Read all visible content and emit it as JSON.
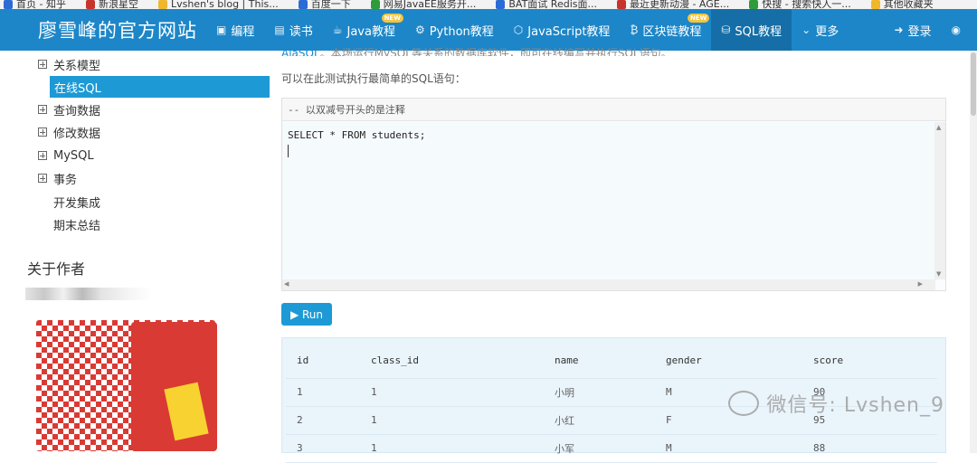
{
  "bookmarks": [
    {
      "label": "首页 - 知乎"
    },
    {
      "label": "新浪星空"
    },
    {
      "label": "Lvshen's blog | This..."
    },
    {
      "label": "百度一下"
    },
    {
      "label": "网易JavaEE服务开..."
    },
    {
      "label": "BAT面试 Redis面..."
    },
    {
      "label": "最近更新动漫 - AGE..."
    },
    {
      "label": "快搜 - 搜索快人一..."
    },
    {
      "label": "其他收藏夹"
    }
  ],
  "nav": {
    "brand": "廖雪峰的官方网站",
    "items": [
      {
        "icon": "▣",
        "label": "编程",
        "new": ""
      },
      {
        "icon": "▤",
        "label": "读书",
        "new": ""
      },
      {
        "icon": "☕",
        "label": "Java教程",
        "new": "NEW"
      },
      {
        "icon": "⚙",
        "label": "Python教程",
        "new": ""
      },
      {
        "icon": "⬡",
        "label": "JavaScript教程",
        "new": ""
      },
      {
        "icon": "₿",
        "label": "区块链教程",
        "new": "NEW"
      },
      {
        "icon": "⛁",
        "label": "SQL教程",
        "new": ""
      },
      {
        "icon": "⌄",
        "label": "更多",
        "new": ""
      }
    ],
    "login": {
      "icon": "➜",
      "label": "登录"
    },
    "globe_icon": "◉"
  },
  "sidebar": {
    "items": [
      {
        "label": "关系模型",
        "expandable": true
      },
      {
        "label": "在线SQL",
        "expandable": false,
        "active": true
      },
      {
        "label": "查询数据",
        "expandable": true
      },
      {
        "label": "修改数据",
        "expandable": true
      },
      {
        "label": "MySQL",
        "expandable": true
      },
      {
        "label": "事务",
        "expandable": true
      },
      {
        "label": "开发集成",
        "expandable": false
      },
      {
        "label": "期末总结",
        "expandable": false
      }
    ],
    "about_title": "关于作者"
  },
  "content": {
    "cut_line_link": "AlaSQL",
    "cut_line_text": "。本场运行MySQL等关系的数据库软件，即可在线编写并执行SQL语句。",
    "intro": "可以在此测试执行最简单的SQL语句：",
    "editor": {
      "comment": "-- 以双减号开头的是注释",
      "code": "SELECT * FROM students;"
    },
    "run_button": "▶ Run",
    "result": {
      "headers": [
        "id",
        "class_id",
        "name",
        "gender",
        "score"
      ],
      "rows": [
        [
          "1",
          "1",
          "小明",
          "M",
          "90"
        ],
        [
          "2",
          "1",
          "小红",
          "F",
          "95"
        ],
        [
          "3",
          "1",
          "小军",
          "M",
          "88"
        ]
      ]
    }
  },
  "watermark": "微信号: Lvshen_9"
}
